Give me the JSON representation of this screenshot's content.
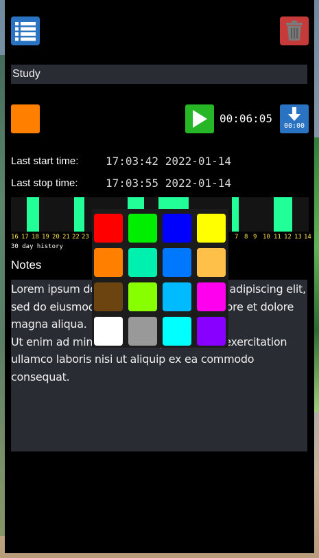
{
  "toolbar": {
    "list_icon": "list-icon",
    "trash_icon": "trash-icon"
  },
  "task": {
    "title": "Study",
    "color": "#ff7f00",
    "timer": "00:06:05",
    "download_label": "00:00"
  },
  "times": {
    "start_label": "Last start time:",
    "start_value": "17:03:42 2022-01-14",
    "stop_label": "Last stop time:",
    "stop_value": "17:03:55 2022-01-14"
  },
  "history": {
    "day_labels_left": [
      "16",
      "17",
      "18",
      "19",
      "20",
      "21",
      "22",
      "23"
    ],
    "day_labels_right": [
      "7",
      "8",
      "9",
      "10",
      "11",
      "12",
      "13",
      "14"
    ],
    "caption": "30 day history",
    "bar_color": "#22ff99",
    "label_color": "#ffe44a"
  },
  "notes": {
    "title": "Notes",
    "text": "Lorem ipsum dolor sit amet, consectetur adipiscing elit, sed do eiusmod tempor incididunt ut labore et dolore magna aliqua.\nUt enim ad minim veniam, quis nostrud exercitation ullamco laboris nisi ut aliquip ex ea commodo consequat."
  },
  "color_picker": {
    "swatches": [
      "#ff0000",
      "#00ee00",
      "#0000ff",
      "#ffff00",
      "#ff7f00",
      "#00f0b0",
      "#0077ff",
      "#ffc04a",
      "#6b4410",
      "#88ff00",
      "#00bbff",
      "#ff00ee",
      "#ffffff",
      "#999999",
      "#00ffff",
      "#8800ff"
    ]
  }
}
